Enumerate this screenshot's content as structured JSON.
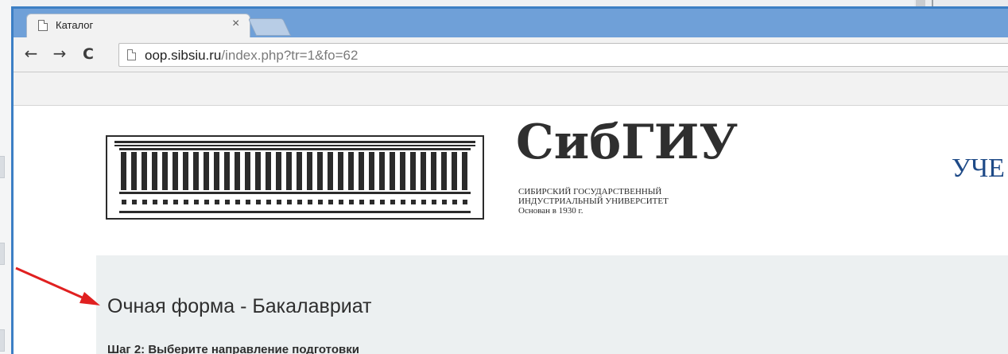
{
  "browser": {
    "tab": {
      "title": "Каталог",
      "close_glyph": "×"
    },
    "nav": {
      "back_glyph": "←",
      "forward_glyph": "→",
      "reload_glyph": "C"
    },
    "address": {
      "host": "oop.sibsiu.ru",
      "path": "/index.php?tr=1&fo=62"
    }
  },
  "header": {
    "logo_icon": "university-building-icon",
    "brand_name": "СибГИУ",
    "brand_sub": [
      "СИБИРСКИЙ ГОСУДАРСТВЕННЫЙ",
      "ИНДУСТРИАЛЬНЫЙ УНИВЕРСИТЕТ",
      "Основан в 1930 г."
    ],
    "right_text_fragment": "УЧЕ"
  },
  "main": {
    "title": "Очная форма - Бакалавриат",
    "step": "Шаг 2: Выберите направление подготовки"
  },
  "annotation": {
    "arrow_color": "#e02020"
  },
  "colors": {
    "window_border": "#3c7fc5",
    "titlebar": "#6fa0d8",
    "brand_blue": "#1e4a87",
    "panel_bg": "#ecf0f1"
  }
}
